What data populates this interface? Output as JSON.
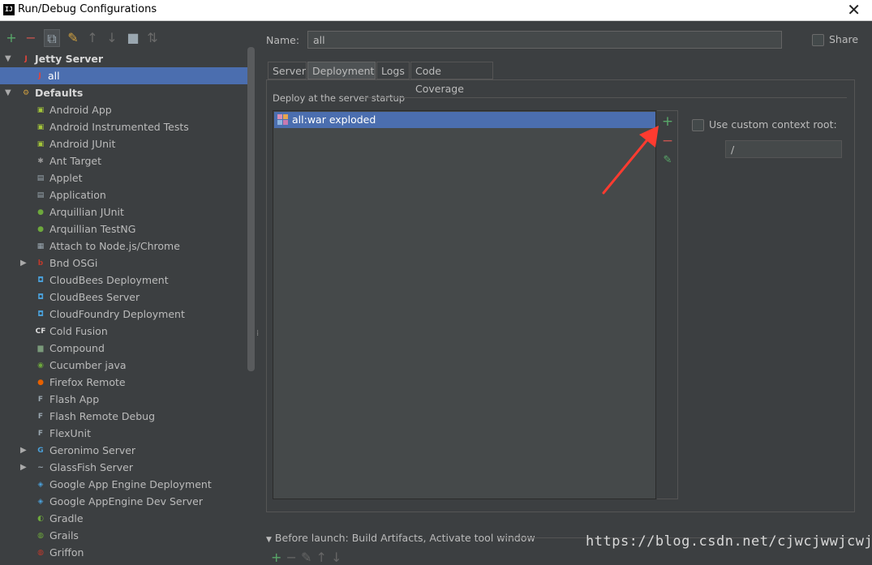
{
  "window": {
    "title": "Run/Debug Configurations",
    "app_icon": "IJ"
  },
  "toolbar": {
    "buttons": [
      {
        "name": "add-config-button",
        "glyph": "+",
        "color": "#59a869"
      },
      {
        "name": "remove-config-button",
        "glyph": "−",
        "color": "#c75450"
      },
      {
        "name": "copy-config-button",
        "glyph": "⧉",
        "color": "#9aa7b0"
      },
      {
        "name": "edit-defaults-button",
        "glyph": "✎",
        "color": "#d0a040"
      },
      {
        "name": "move-up-button",
        "glyph": "↑",
        "color": "#6a6a6a"
      },
      {
        "name": "move-down-button",
        "glyph": "↓",
        "color": "#6a6a6a"
      },
      {
        "name": "folder-button",
        "glyph": "■",
        "color": "#9aa7b0"
      },
      {
        "name": "sort-button",
        "glyph": "⇅",
        "color": "#6a6a6a"
      }
    ]
  },
  "tree": {
    "jetty_server": "Jetty Server",
    "jetty_all": "all",
    "defaults": "Defaults",
    "items": [
      {
        "label": "Android App",
        "icon": "android-icon",
        "color": "#a4c639",
        "glyph": "▣"
      },
      {
        "label": "Android Instrumented Tests",
        "icon": "android-test-icon",
        "color": "#a4c639",
        "glyph": "▣"
      },
      {
        "label": "Android JUnit",
        "icon": "android-junit-icon",
        "color": "#a4c639",
        "glyph": "▣"
      },
      {
        "label": "Ant Target",
        "icon": "ant-icon",
        "color": "#999999",
        "glyph": "✱"
      },
      {
        "label": "Applet",
        "icon": "applet-icon",
        "color": "#9aa7b0",
        "glyph": "▤"
      },
      {
        "label": "Application",
        "icon": "application-icon",
        "color": "#9aa7b0",
        "glyph": "▤"
      },
      {
        "label": "Arquillian JUnit",
        "icon": "arquillian-icon",
        "color": "#6da83c",
        "glyph": "●"
      },
      {
        "label": "Arquillian TestNG",
        "icon": "arquillian-icon",
        "color": "#6da83c",
        "glyph": "●"
      },
      {
        "label": "Attach to Node.js/Chrome",
        "icon": "nodejs-icon",
        "color": "#9aa7b0",
        "glyph": "▦"
      },
      {
        "label": "Bnd OSGi",
        "icon": "bnd-icon",
        "color": "#c0392b",
        "glyph": "b",
        "expandable": true
      },
      {
        "label": "CloudBees Deployment",
        "icon": "cloudbees-icon",
        "color": "#4a9fd8",
        "glyph": "◘"
      },
      {
        "label": "CloudBees Server",
        "icon": "cloudbees-icon",
        "color": "#4a9fd8",
        "glyph": "◘"
      },
      {
        "label": "CloudFoundry Deployment",
        "icon": "cloudfoundry-icon",
        "color": "#4a9fd8",
        "glyph": "◘"
      },
      {
        "label": "Cold Fusion",
        "icon": "coldfusion-icon",
        "color": "#dddddd",
        "glyph": "CF"
      },
      {
        "label": "Compound",
        "icon": "compound-icon",
        "color": "#7a9a7a",
        "glyph": "▆"
      },
      {
        "label": "Cucumber java",
        "icon": "cucumber-icon",
        "color": "#6da83c",
        "glyph": "◉"
      },
      {
        "label": "Firefox Remote",
        "icon": "firefox-icon",
        "color": "#e66000",
        "glyph": "●"
      },
      {
        "label": "Flash App",
        "icon": "flash-icon",
        "color": "#9aa7b0",
        "glyph": "F"
      },
      {
        "label": "Flash Remote Debug",
        "icon": "flash-debug-icon",
        "color": "#9aa7b0",
        "glyph": "F"
      },
      {
        "label": "FlexUnit",
        "icon": "flexunit-icon",
        "color": "#9aa7b0",
        "glyph": "F"
      },
      {
        "label": "Geronimo Server",
        "icon": "geronimo-icon",
        "color": "#4a9fd8",
        "glyph": "G",
        "expandable": true
      },
      {
        "label": "GlassFish Server",
        "icon": "glassfish-icon",
        "color": "#9aa7b0",
        "glyph": "~",
        "expandable": true
      },
      {
        "label": "Google App Engine Deployment",
        "icon": "appengine-icon",
        "color": "#4a9fd8",
        "glyph": "◈"
      },
      {
        "label": "Google AppEngine Dev Server",
        "icon": "appengine-icon",
        "color": "#4a9fd8",
        "glyph": "◈"
      },
      {
        "label": "Gradle",
        "icon": "gradle-icon",
        "color": "#6da83c",
        "glyph": "◐"
      },
      {
        "label": "Grails",
        "icon": "grails-icon",
        "color": "#6da83c",
        "glyph": "◍"
      },
      {
        "label": "Griffon",
        "icon": "griffon-icon",
        "color": "#c0392b",
        "glyph": "◍"
      }
    ]
  },
  "form": {
    "name_label": "Name:",
    "name_value": "all",
    "share_label": "Share",
    "tabs": [
      "Server",
      "Deployment",
      "Logs",
      "Code Coverage"
    ],
    "active_tab": "Deployment",
    "deploy_label": "Deploy at the server startup",
    "artifacts": [
      "all:war exploded"
    ],
    "context_root_label": "Use custom context root:",
    "context_root_value": "/",
    "before_launch": "Before launch: Build Artifacts, Activate tool window"
  },
  "watermark": "https://blog.csdn.net/cjwcjwwjcwjc",
  "colors": {
    "background": "#3c3f41",
    "selection": "#4b6eaf",
    "add": "#59a869",
    "remove": "#c75450",
    "annotation_arrow": "#ff3b30"
  }
}
